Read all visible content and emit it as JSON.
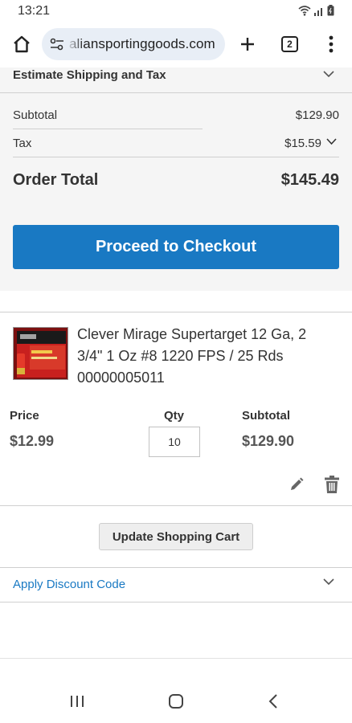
{
  "status_bar": {
    "time": "13:21"
  },
  "browser": {
    "url": "aliansportinggoods.com",
    "tab_count": "2"
  },
  "summary": {
    "estimate_label": "Estimate Shipping and Tax",
    "subtotal_label": "Subtotal",
    "subtotal_value": "$129.90",
    "tax_label": "Tax",
    "tax_value": "$15.59",
    "order_total_label": "Order Total",
    "order_total_value": "$145.49",
    "checkout_label": "Proceed to Checkout"
  },
  "item": {
    "name": "Clever Mirage Supertarget 12 Ga, 2 3/4\" 1 Oz #8 1220 FPS / 25 Rds 00000005011",
    "price_label": "Price",
    "price_value": "$12.99",
    "qty_label": "Qty",
    "qty_value": "10",
    "subtotal_label": "Subtotal",
    "subtotal_value": "$129.90"
  },
  "actions": {
    "update_cart_label": "Update Shopping Cart",
    "discount_label": "Apply Discount Code"
  },
  "colors": {
    "accent": "#1979c3",
    "summary_bg": "#f5f5f5"
  },
  "icons": [
    "home-icon",
    "site-settings-icon",
    "plus-icon",
    "tabs-icon",
    "more-vert-icon",
    "chevron-down-icon",
    "pencil-icon",
    "trash-icon",
    "recents-icon",
    "nav-home-icon",
    "back-icon"
  ]
}
